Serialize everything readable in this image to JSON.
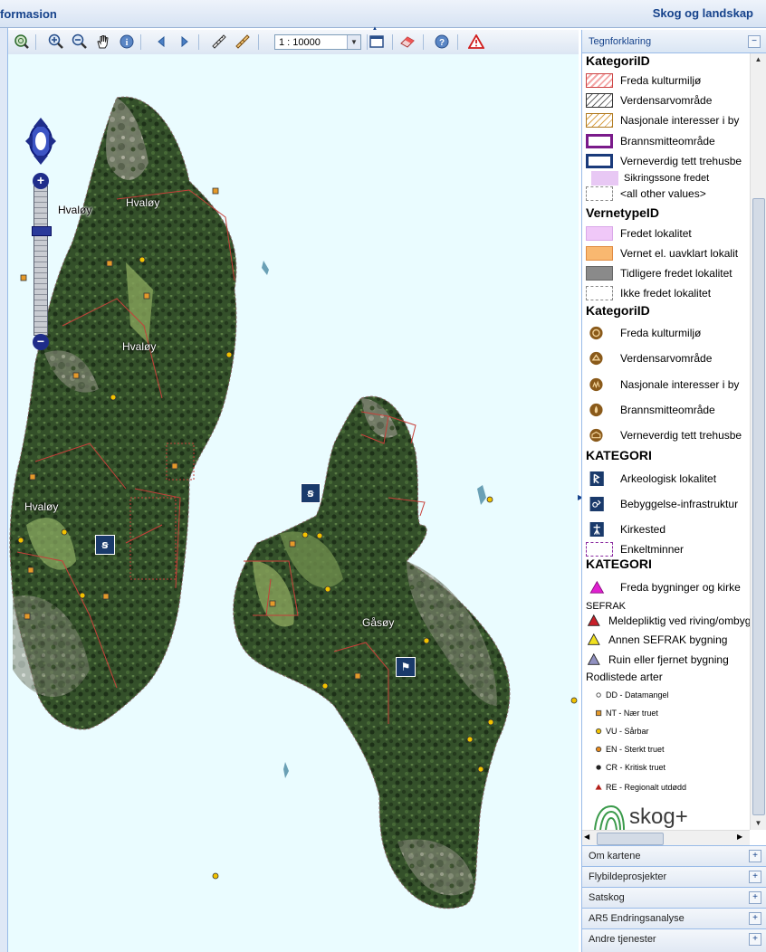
{
  "header": {
    "left_title": "formasion",
    "right_title": "Skog og landskap"
  },
  "toolbar": {
    "scale_value": "1 : 10000",
    "icons": [
      "zoom-full-extent-icon",
      "zoom-in-icon",
      "zoom-out-icon",
      "pan-hand-icon",
      "info-icon",
      "back-arrow-icon",
      "forward-arrow-icon",
      "measure-line-icon",
      "measure-area-icon",
      "window-icon",
      "eraser-icon",
      "help-icon",
      "warning-icon"
    ]
  },
  "map": {
    "place_names": [
      {
        "text": "Hvaløy",
        "style": "dark"
      },
      {
        "text": "Hvaløy",
        "style": "white"
      },
      {
        "text": "Hvaløy",
        "style": "white"
      },
      {
        "text": "Hvaløy",
        "style": "white"
      },
      {
        "text": "Gåsøy",
        "style": "white"
      }
    ],
    "colors": {
      "sea": "#eafcff",
      "forest": "#2f4a26",
      "boundary": "#c0403a",
      "point": "#f2c200"
    }
  },
  "legend": {
    "title": "Tegnforklaring",
    "groups": [
      {
        "heading": "KategoriID",
        "items": [
          {
            "label": "Freda kulturmiljø",
            "swatch": "hatch-red"
          },
          {
            "label": "Verdensarvområde",
            "swatch": "hatch-black"
          },
          {
            "label": "Nasjonale interesser i by",
            "swatch": "hatch-orange"
          },
          {
            "label": "Brannsmitteområde",
            "swatch": "outline-purple"
          },
          {
            "label": "Verneverdig tett trehusbe",
            "swatch": "outline-navy"
          },
          {
            "label": "Sikringssone fredet",
            "swatch": "fill-lilac"
          },
          {
            "label": "<all other values>",
            "swatch": "dashed"
          }
        ]
      },
      {
        "heading": "VernetypeID",
        "items": [
          {
            "label": "Fredet lokalitet",
            "swatch": "fill-pink"
          },
          {
            "label": "Vernet el. uavklart lokalit",
            "swatch": "fill-orange"
          },
          {
            "label": "Tidligere fredet lokalitet",
            "swatch": "fill-grey"
          },
          {
            "label": "Ikke fredet lokalitet",
            "swatch": "dashed"
          }
        ]
      },
      {
        "heading": "KategoriID",
        "items": [
          {
            "label": "Freda kulturmiljø",
            "swatch": "brown-circle"
          },
          {
            "label": "Verdensarvområde",
            "swatch": "brown-circle"
          },
          {
            "label": "Nasjonale interesser i by",
            "swatch": "brown-circle"
          },
          {
            "label": "Brannsmitteområde",
            "swatch": "brown-circle"
          },
          {
            "label": "Verneverdig tett trehusbe",
            "swatch": "brown-circle"
          }
        ]
      },
      {
        "heading": "KATEGORI",
        "items": [
          {
            "label": "Arkeologisk lokalitet",
            "swatch": "navy-square"
          },
          {
            "label": "Bebyggelse-infrastruktur",
            "swatch": "navy-square"
          },
          {
            "label": "Kirkested",
            "swatch": "navy-square"
          },
          {
            "label": "Enkeltminner",
            "swatch": "dashed-purple"
          }
        ]
      },
      {
        "heading": "KATEGORI",
        "items": [
          {
            "label": "Freda bygninger og kirke",
            "swatch": "magenta-triangle"
          }
        ]
      }
    ],
    "sefrak": {
      "label": "SEFRAK",
      "items": [
        {
          "label": "Meldepliktig ved riving/ombyg",
          "color": "#c8202a"
        },
        {
          "label": "Annen SEFRAK bygning",
          "color": "#f0e020"
        },
        {
          "label": "Ruin eller fjernet bygning",
          "color": "#9090c0"
        }
      ]
    },
    "rodlistede": {
      "label": "Rodlistede arter",
      "items": [
        {
          "label": "DD - Datamangel",
          "symbol": "circle-open"
        },
        {
          "label": "NT - Nær truet",
          "symbol": "square-orange"
        },
        {
          "label": "VU - Sårbar",
          "symbol": "circle-yellow"
        },
        {
          "label": "EN - Sterkt truet",
          "symbol": "circle-orange"
        },
        {
          "label": "CR - Kritisk truet",
          "symbol": "circle-dark"
        },
        {
          "label": "RE - Regionalt utdødd",
          "symbol": "triangle-red"
        }
      ]
    },
    "logo_text": "skog+"
  },
  "accordion": [
    {
      "label": "Om kartene"
    },
    {
      "label": "Flybildeprosjekter"
    },
    {
      "label": "Satskog"
    },
    {
      "label": "AR5 Endringsanalyse"
    },
    {
      "label": "Andre tjenester"
    }
  ]
}
